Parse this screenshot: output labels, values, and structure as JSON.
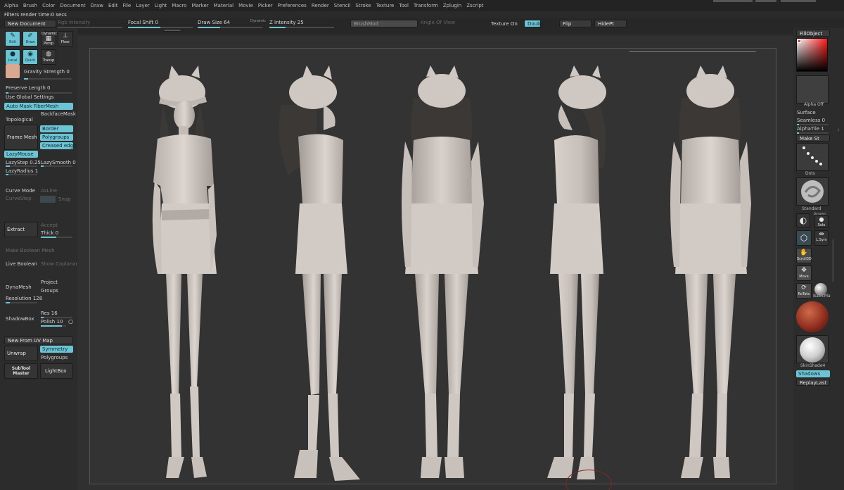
{
  "menu": [
    "Alpha",
    "Brush",
    "Color",
    "Document",
    "Draw",
    "Edit",
    "File",
    "Layer",
    "Light",
    "Macro",
    "Marker",
    "Material",
    "Movie",
    "Picker",
    "Preferences",
    "Render",
    "Stencil",
    "Stroke",
    "Texture",
    "Tool",
    "Transform",
    "Zplugin",
    "Zscript"
  ],
  "status": "Filters render time:0 secs",
  "toolbar": {
    "new_document": "New Document",
    "rgb_intensity": "Rgb Intensity",
    "focal_shift_label": "Focal Shift",
    "focal_shift_value": "0",
    "focal_shift_level": 0.5,
    "draw_size_label": "Draw Size",
    "draw_size_value": "64",
    "draw_size_level": 0.35,
    "dynamic": "Dynamic",
    "z_intensity_label": "Z Intensity",
    "z_intensity_value": "25",
    "z_intensity_level": 0.25,
    "brush_mod": "BrushMod",
    "angle_of_view": "Angle Of View",
    "texture_on": "Texture On",
    "double": "Double",
    "flip": "Flip",
    "hide_pt": "HidePt"
  },
  "left": {
    "tiles": [
      "Edit",
      "Draw",
      "Dynamic",
      "Persp",
      "Floor",
      "Local",
      "Quick",
      "Transp"
    ],
    "gravity_label": "Gravity Strength",
    "gravity_value": "0",
    "preserve_label": "Preserve Length",
    "preserve_value": "0",
    "use_global": "Use Global Settings",
    "auto_mask": "Auto Mask FiberMesh",
    "backface": "BackfaceMask",
    "topological": "Topological",
    "frame_mesh": "Frame Mesh",
    "border": "Border",
    "polygroups": "Polygroups",
    "creased": "Creased edges",
    "lazy_mouse": "LazyMouse",
    "lazy_step_label": "LazyStep",
    "lazy_step_value": "0.25",
    "lazy_smooth_label": "LazySmooth",
    "lazy_smooth_value": "0",
    "lazy_radius_label": "LazyRadius",
    "lazy_radius_value": "1",
    "curve_mode": "Curve Mode",
    "as_line": "AsLine",
    "curve_step": "CurveStep",
    "snap": "Snap",
    "extract": "Extract",
    "accept": "Accept",
    "thick_label": "Thick",
    "thick_value": "0",
    "make_boolean": "Make Boolean Mesh",
    "live_boolean": "Live Boolean",
    "show_coplanar": "Show Coplanar",
    "dynamesh": "DynaMesh",
    "project": "Project",
    "groups": "Groups",
    "resolution_label": "Resolution",
    "resolution_value": "128",
    "shadowbox": "ShadowBox",
    "res_label": "Res",
    "res_value": "16",
    "polish_label": "Polish",
    "polish_value": "10",
    "new_uv": "New From UV Map",
    "unwrap": "Unwrap",
    "symmetry": "Symmetry",
    "polygroups2": "Polygroups",
    "subtool_master": "SubTool Master",
    "lightbox": "LightBox"
  },
  "right": {
    "fill_object": "FillObject",
    "alpha_off": "Alpha Off",
    "surface": "Surface",
    "seamless_label": "Seamless",
    "seamless_value": "0",
    "alphatile_label": "AlphaTile",
    "alphatile_value": "1",
    "make_st": "Make St",
    "dots": "Dots",
    "standard": "Standard",
    "dynamic": "Dynamic",
    "solo": "Solo",
    "l_sym": "L.Sym",
    "scroll3d": "Scroll3D",
    "move": "Move",
    "rotate": "RoTate",
    "basic_ma": "BasicMa",
    "skinshade": "SkinShade4",
    "shadows": "Shadows",
    "replay_last": "ReplayLast"
  },
  "colors": {
    "accent": "#6cc3d4",
    "figure": "#d4ccc6",
    "figure_shadow": "#9a928c",
    "hair": "#3c3836"
  }
}
